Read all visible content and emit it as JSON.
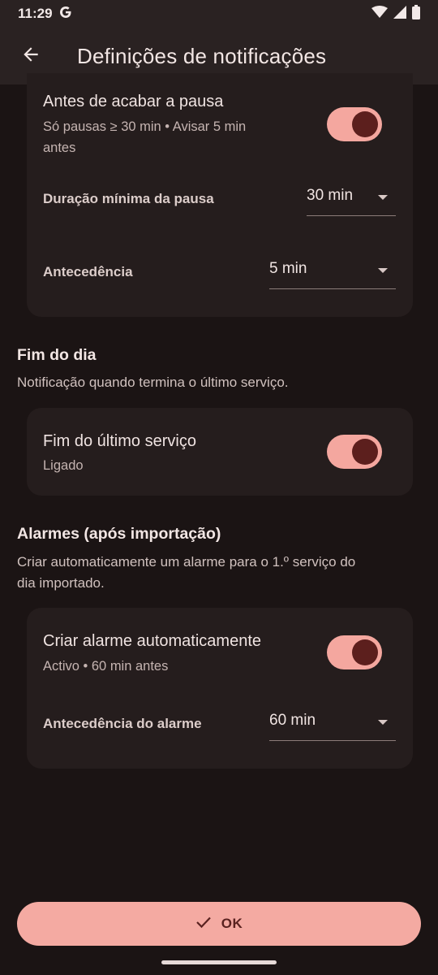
{
  "status_bar": {
    "time": "11:29",
    "icons": [
      "google-g-icon",
      "wifi-icon",
      "signal-icon",
      "battery-icon"
    ]
  },
  "app_bar": {
    "back_icon": "arrow-back-icon",
    "title": "Definições de notificações"
  },
  "pause_card": {
    "title": "Antes de acabar a pausa",
    "subtitle_line1": "Só pausas ≥ 30 min • Avisar 5 min",
    "subtitle_line2": "antes",
    "toggle_on": true,
    "min_duration_label": "Duração mínima da pausa",
    "min_duration_value": "30 min",
    "advance_label": "Antecedência",
    "advance_value": "5 min"
  },
  "end_of_day": {
    "section_title": "Fim do dia",
    "section_desc": "Notificação quando termina o último serviço.",
    "card_title": "Fim do último serviço",
    "card_subtitle": "Ligado",
    "toggle_on": true
  },
  "alarms": {
    "section_title": "Alarmes (após importação)",
    "section_desc_line1": "Criar automaticamente um alarme para o 1.º serviço do",
    "section_desc_line2": "dia importado.",
    "card_title": "Criar alarme automaticamente",
    "card_subtitle": "Activo • 60 min antes",
    "toggle_on": true,
    "alarm_advance_label": "Antecedência do alarme",
    "alarm_advance_value": "60 min"
  },
  "ok_button": {
    "label": "OK",
    "icon": "check-icon"
  },
  "colors": {
    "background": "#1b1414",
    "surface": "#251d1d",
    "accent": "#f4aaa2",
    "accent_dark": "#5c1f1d"
  }
}
